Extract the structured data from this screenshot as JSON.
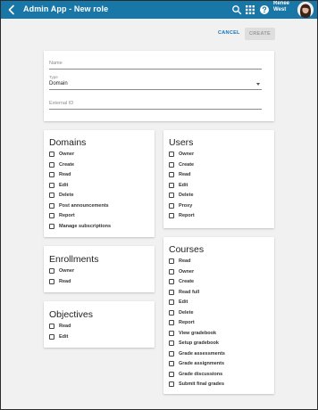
{
  "header": {
    "title": "Admin App - New role",
    "user_first": "Renee",
    "user_last": "West"
  },
  "actions": {
    "cancel_label": "CANCEL",
    "create_label": "CREATE"
  },
  "form": {
    "name_label": "Name",
    "name_value": "",
    "type_label": "Type",
    "type_value": "Domain",
    "external_id_label": "External ID",
    "external_id_value": ""
  },
  "sections": {
    "domains": {
      "title": "Domains",
      "items": [
        "Owner",
        "Create",
        "Read",
        "Edit",
        "Delete",
        "Post announcements",
        "Report",
        "Manage subscriptions"
      ]
    },
    "users": {
      "title": "Users",
      "items": [
        "Owner",
        "Create",
        "Read",
        "Edit",
        "Delete",
        "Proxy",
        "Report"
      ]
    },
    "enrollments": {
      "title": "Enrollments",
      "items": [
        "Owner",
        "Read"
      ]
    },
    "courses": {
      "title": "Courses",
      "items": [
        "Read",
        "Owner",
        "Create",
        "Read full",
        "Edit",
        "Delete",
        "Report",
        "View gradebook",
        "Setup gradebook",
        "Grade assessments",
        "Grade assignments",
        "Grade discussions",
        "Submit final grades"
      ]
    },
    "objectives": {
      "title": "Objectives",
      "items": [
        "Read",
        "Edit"
      ]
    }
  },
  "colors": {
    "topbar": "#1977a8",
    "accent": "#1a73b8"
  }
}
